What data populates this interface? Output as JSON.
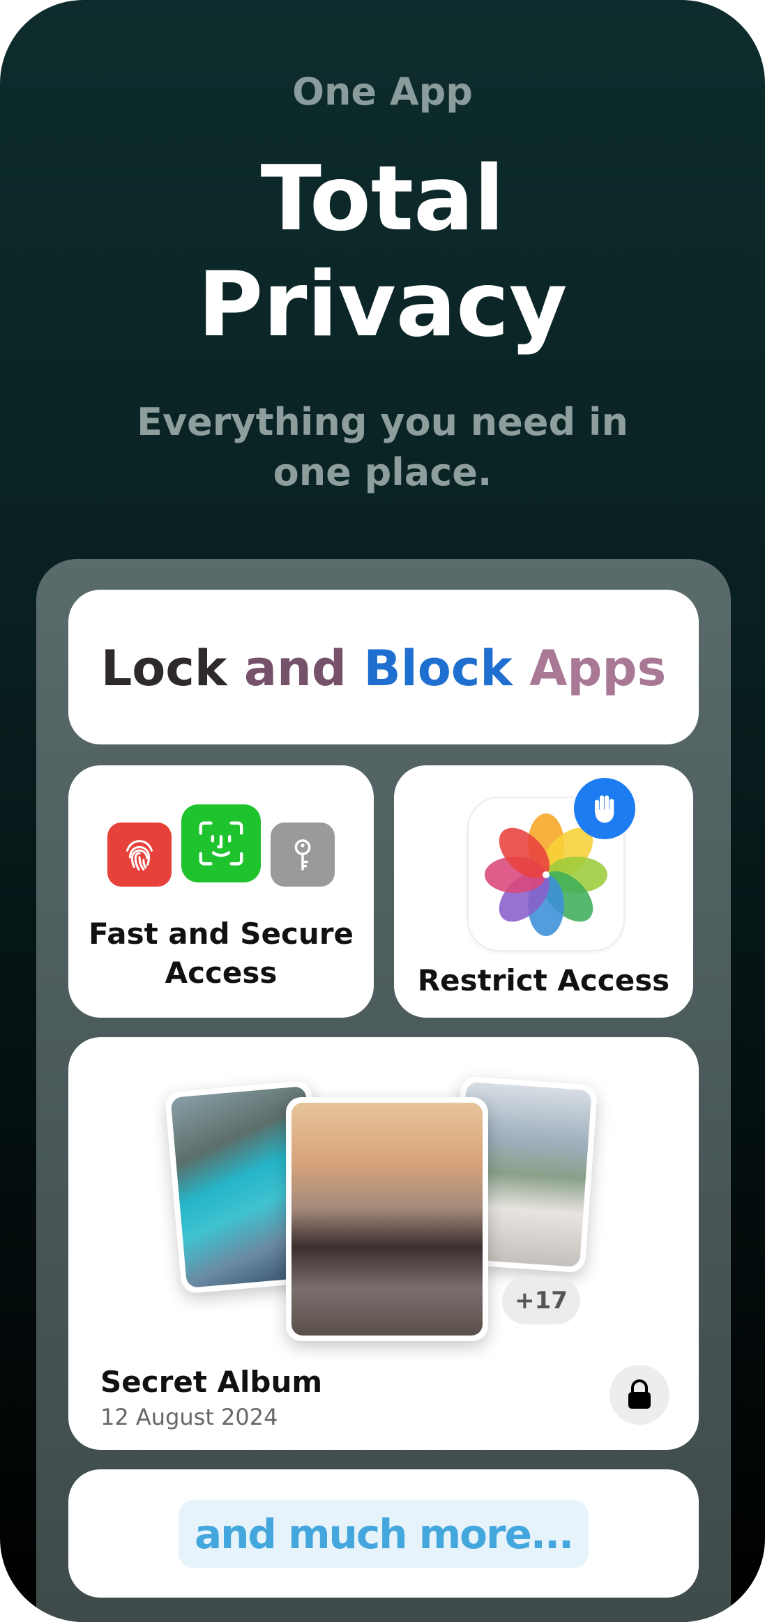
{
  "header": {
    "kicker": "One App",
    "title_line1": "Total",
    "title_line2": "Privacy",
    "subtitle": "Everything you need in one place."
  },
  "hero": {
    "word1": "Lock",
    "word2": "and",
    "word3": "Block",
    "word4": "Apps",
    "colors": [
      "#2e2a2c",
      "#75526a",
      "#1f6fd0",
      "#a87894"
    ]
  },
  "access_card": {
    "label_line1": "Fast and Secure",
    "label_line2": "Access",
    "icons": [
      "fingerprint-icon",
      "face-id-icon",
      "key-icon"
    ]
  },
  "restrict_card": {
    "label": "Restrict Access",
    "icons": [
      "photos-app-icon",
      "hand-stop-icon"
    ]
  },
  "album_card": {
    "name": "Secret Album",
    "date": "12 August 2024",
    "extra_count": "+17",
    "icons": [
      "lock-icon"
    ]
  },
  "more": {
    "label": "and much more..."
  },
  "colors": {
    "background_top": "#0e2c2d",
    "background_bottom": "#000000",
    "accent_blue": "#1d7cf2",
    "more_text": "#43a6dc"
  }
}
